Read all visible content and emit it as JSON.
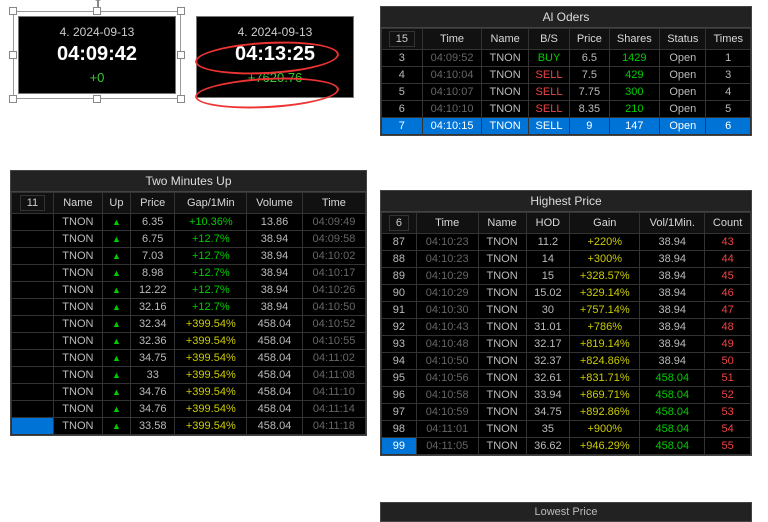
{
  "clock1": {
    "date": "4. 2024-09-13",
    "time": "04:09:42",
    "delta": "+0"
  },
  "clock2": {
    "date": "4. 2024-09-13",
    "time": "04:13:25",
    "delta": "+7620.76"
  },
  "two_minutes": {
    "title": "Two Minutes Up",
    "corner": "11",
    "headers": [
      "Name",
      "Up",
      "Price",
      "Gap/1Min",
      "Volume",
      "Time"
    ],
    "rows": [
      {
        "name": "TNON",
        "up": "▲",
        "price": "6.35",
        "gap": "+10.36%",
        "vol": "13.86",
        "time": "04:09:49",
        "gapClass": "green"
      },
      {
        "name": "TNON",
        "up": "▲",
        "price": "6.75",
        "gap": "+12.7%",
        "vol": "38.94",
        "time": "04:09:58",
        "gapClass": "green"
      },
      {
        "name": "TNON",
        "up": "▲",
        "price": "7.03",
        "gap": "+12.7%",
        "vol": "38.94",
        "time": "04:10:02",
        "gapClass": "green"
      },
      {
        "name": "TNON",
        "up": "▲",
        "price": "8.98",
        "gap": "+12.7%",
        "vol": "38.94",
        "time": "04:10:17",
        "gapClass": "green"
      },
      {
        "name": "TNON",
        "up": "▲",
        "price": "12.22",
        "gap": "+12.7%",
        "vol": "38.94",
        "time": "04:10:26",
        "gapClass": "green"
      },
      {
        "name": "TNON",
        "up": "▲",
        "price": "32.16",
        "gap": "+12.7%",
        "vol": "38.94",
        "time": "04:10:50",
        "gapClass": "green"
      },
      {
        "name": "TNON",
        "up": "▲",
        "price": "32.34",
        "gap": "+399.54%",
        "vol": "458.04",
        "time": "04:10:52",
        "gapClass": "yellow"
      },
      {
        "name": "TNON",
        "up": "▲",
        "price": "32.36",
        "gap": "+399.54%",
        "vol": "458.04",
        "time": "04:10:55",
        "gapClass": "yellow"
      },
      {
        "name": "TNON",
        "up": "▲",
        "price": "34.75",
        "gap": "+399.54%",
        "vol": "458.04",
        "time": "04:11:02",
        "gapClass": "yellow"
      },
      {
        "name": "TNON",
        "up": "▲",
        "price": "33",
        "gap": "+399.54%",
        "vol": "458.04",
        "time": "04:11:08",
        "gapClass": "yellow"
      },
      {
        "name": "TNON",
        "up": "▲",
        "price": "34.76",
        "gap": "+399.54%",
        "vol": "458.04",
        "time": "04:11:10",
        "gapClass": "yellow"
      },
      {
        "name": "TNON",
        "up": "▲",
        "price": "34.76",
        "gap": "+399.54%",
        "vol": "458.04",
        "time": "04:11:14",
        "gapClass": "yellow"
      },
      {
        "name": "TNON",
        "up": "▲",
        "price": "33.58",
        "gap": "+399.54%",
        "vol": "458.04",
        "time": "04:11:18",
        "gapClass": "yellow",
        "sel": true
      }
    ]
  },
  "al_orders": {
    "title": "Al Oders",
    "corner": "15",
    "headers": [
      "Time",
      "Name",
      "B/S",
      "Price",
      "Shares",
      "Status",
      "Times"
    ],
    "rows": [
      {
        "n": "3",
        "time": "04:09:52",
        "name": "TNON",
        "bs": "BUY",
        "bsClass": "green",
        "price": "6.5",
        "shares": "1429",
        "sharesClass": "green",
        "status": "Open",
        "times": "1"
      },
      {
        "n": "4",
        "time": "04:10:04",
        "name": "TNON",
        "bs": "SELL",
        "bsClass": "red",
        "price": "7.5",
        "shares": "429",
        "sharesClass": "green",
        "status": "Open",
        "times": "3"
      },
      {
        "n": "5",
        "time": "04:10:07",
        "name": "TNON",
        "bs": "SELL",
        "bsClass": "red",
        "price": "7.75",
        "shares": "300",
        "sharesClass": "green",
        "status": "Open",
        "times": "4"
      },
      {
        "n": "6",
        "time": "04:10:10",
        "name": "TNON",
        "bs": "SELL",
        "bsClass": "red",
        "price": "8.35",
        "shares": "210",
        "sharesClass": "green",
        "status": "Open",
        "times": "5"
      },
      {
        "n": "7",
        "time": "04:10:15",
        "name": "TNON",
        "bs": "SELL",
        "bsClass": "",
        "price": "9",
        "shares": "147",
        "sharesClass": "",
        "status": "Open",
        "times": "6",
        "sel": true
      }
    ]
  },
  "highest": {
    "title": "Highest Price",
    "corner": "6",
    "headers": [
      "Time",
      "Name",
      "HOD",
      "Gain",
      "Vol/1Min.",
      "Count"
    ],
    "rows": [
      {
        "n": "87",
        "time": "04:10:23",
        "name": "TNON",
        "hod": "11.2",
        "gain": "+220%",
        "vol": "38.94",
        "count": "43"
      },
      {
        "n": "88",
        "time": "04:10:23",
        "name": "TNON",
        "hod": "14",
        "gain": "+300%",
        "vol": "38.94",
        "count": "44"
      },
      {
        "n": "89",
        "time": "04:10:29",
        "name": "TNON",
        "hod": "15",
        "gain": "+328.57%",
        "vol": "38.94",
        "count": "45"
      },
      {
        "n": "90",
        "time": "04:10:29",
        "name": "TNON",
        "hod": "15.02",
        "gain": "+329.14%",
        "vol": "38.94",
        "count": "46"
      },
      {
        "n": "91",
        "time": "04:10:30",
        "name": "TNON",
        "hod": "30",
        "gain": "+757.14%",
        "vol": "38.94",
        "count": "47"
      },
      {
        "n": "92",
        "time": "04:10:43",
        "name": "TNON",
        "hod": "31.01",
        "gain": "+786%",
        "vol": "38.94",
        "count": "48"
      },
      {
        "n": "93",
        "time": "04:10:48",
        "name": "TNON",
        "hod": "32.17",
        "gain": "+819.14%",
        "vol": "38.94",
        "count": "49"
      },
      {
        "n": "94",
        "time": "04:10:50",
        "name": "TNON",
        "hod": "32.37",
        "gain": "+824.86%",
        "vol": "38.94",
        "count": "50"
      },
      {
        "n": "95",
        "time": "04:10:56",
        "name": "TNON",
        "hod": "32.61",
        "gain": "+831.71%",
        "vol": "458.04",
        "count": "51",
        "volClass": "green"
      },
      {
        "n": "96",
        "time": "04:10:58",
        "name": "TNON",
        "hod": "33.94",
        "gain": "+869.71%",
        "vol": "458.04",
        "count": "52",
        "volClass": "green"
      },
      {
        "n": "97",
        "time": "04:10:59",
        "name": "TNON",
        "hod": "34.75",
        "gain": "+892.86%",
        "vol": "458.04",
        "count": "53",
        "volClass": "green"
      },
      {
        "n": "98",
        "time": "04:11:01",
        "name": "TNON",
        "hod": "35",
        "gain": "+900%",
        "vol": "458.04",
        "count": "54",
        "volClass": "green"
      },
      {
        "n": "99",
        "time": "04:11:05",
        "name": "TNON",
        "hod": "36.62",
        "gain": "+946.29%",
        "vol": "458.04",
        "count": "55",
        "volClass": "green",
        "selNum": true
      }
    ]
  },
  "lowest_title": "Lowest Price"
}
